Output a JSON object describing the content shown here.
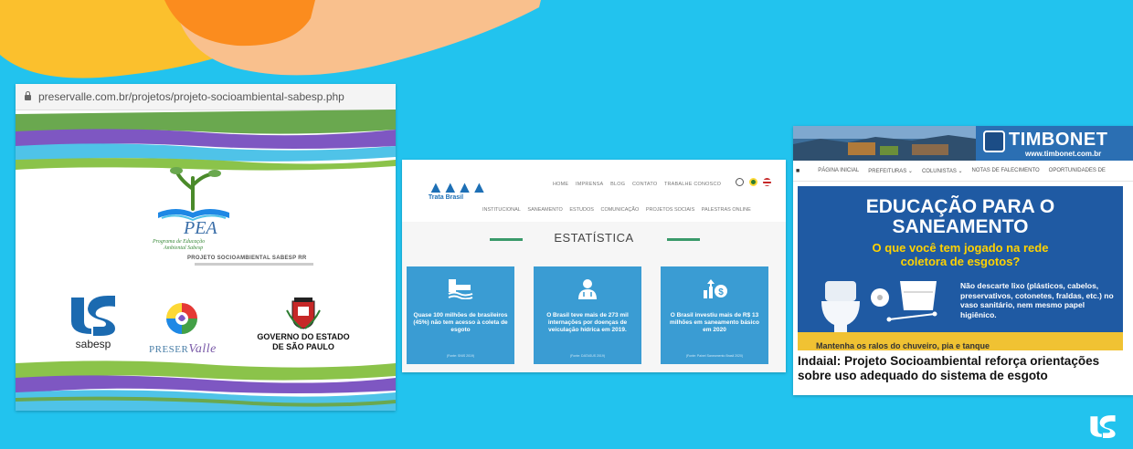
{
  "colors": {
    "background": "#22c3ee",
    "deco_yellow": "#fbc02d",
    "deco_orange": "#fb8c1e",
    "deco_peach": "#f9c08d",
    "sabesp_blue": "#1b6ab0",
    "card_blue": "#3a9cd3"
  },
  "panel1": {
    "url": "preservalle.com.br/projetos/projeto-socioambiental-sabesp.php",
    "pea": {
      "acronym": "PEA",
      "subtitle_line1": "Programa de Educação",
      "subtitle_line2": "Ambiental Sabesp"
    },
    "project_title": "PROJETO SOCIOAMBIENTAL SABESP RR",
    "logos": {
      "sabesp": "sabesp",
      "preservalle_prefix": "PRESER",
      "preservalle_suffix": "Valle",
      "government_line1": "GOVERNO DO ESTADO",
      "government_line2": "DE SÃO PAULO"
    },
    "icons": [
      "lock-icon",
      "pea-book-tree-logo",
      "sabesp-logo",
      "preservalle-globe-logo",
      "sao-paulo-coat-of-arms"
    ]
  },
  "panel2": {
    "brand": "Trata Brasil",
    "top_nav": [
      "HOME",
      "IMPRENSA",
      "BLOG",
      "CONTATO",
      "TRABALHE CONOSCO"
    ],
    "main_nav": [
      "INSTITUCIONAL",
      "SANEAMENTO",
      "ESTUDOS",
      "COMUNICAÇÃO",
      "PROJETOS SOCIAIS",
      "PALESTRAS ONLINE"
    ],
    "section_title": "ESTATÍSTICA",
    "cards": [
      {
        "icon": "sewer-pipe-icon",
        "text": "Quase 100 milhões de brasileiros (45%) não tem acesso à coleta de esgoto",
        "source": "(Fonte: SNIS 2019)"
      },
      {
        "icon": "doctor-icon",
        "text": "O Brasil teve mais de 273 mil internações por doenças de veiculação hídrica em 2019.",
        "source": "(Fonte: DATASUS 2019)"
      },
      {
        "icon": "money-growth-icon",
        "text": "O Brasil investiu mais de R$ 13 milhões em saneamento básico em 2020",
        "source": "(Fonte: Painel Saneamento Brasil 2020)"
      }
    ]
  },
  "panel3": {
    "site_name": "TIMBONET",
    "site_url": "www.timbonet.com.br",
    "nav": [
      "PÁGINA INICIAL",
      "PREFEITURAS ⌄",
      "COLUNISTAS ⌄",
      "NOTAS DE FALECIMENTO",
      "OPORTUNIDADES DE"
    ],
    "banner_title_line1": "EDUCAÇÃO PARA O",
    "banner_title_line2": "SANEAMENTO",
    "banner_subtitle_line1": "O que você tem jogado na rede",
    "banner_subtitle_line2": "coletora de esgotos?",
    "banner_tips": "Não descarte lixo (plásticos, cabelos, preservativos, cotonetes, fraldas, etc.) no vaso sanitário, nem mesmo papel higiênico.",
    "banner_cut_text": "Mantenha os ralos do chuveiro, pia e tanque",
    "caption": "Indaial: Projeto Socioambiental reforça orientações sobre uso adequado do sistema de esgoto"
  }
}
